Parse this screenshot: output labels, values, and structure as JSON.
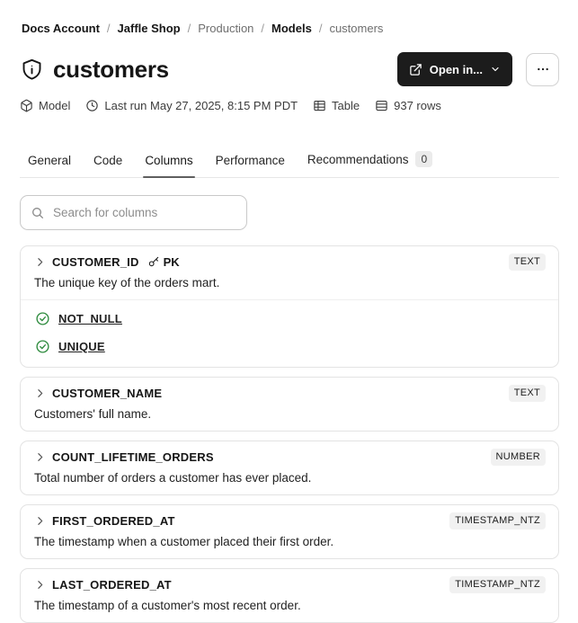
{
  "breadcrumb": {
    "separator": "/",
    "items": [
      {
        "label": "Docs Account",
        "muted": false
      },
      {
        "label": "Jaffle Shop",
        "muted": false
      },
      {
        "label": "Production",
        "muted": true
      },
      {
        "label": "Models",
        "muted": false
      },
      {
        "label": "customers",
        "muted": true
      }
    ]
  },
  "header": {
    "title": "customers",
    "resource_icon": "shield-exclamation-icon",
    "actions": {
      "open_in_label": "Open in...",
      "open_in_icons": [
        "external-link-icon",
        "chevron-down-icon"
      ],
      "more_icon": "ellipsis-icon"
    }
  },
  "meta": {
    "items": [
      {
        "icon": "cube-icon",
        "label": "Model"
      },
      {
        "icon": "clock-icon",
        "label": "Last run May 27, 2025, 8:15 PM PDT"
      },
      {
        "icon": "table-icon",
        "label": "Table"
      },
      {
        "icon": "rows-icon",
        "label": "937 rows"
      }
    ]
  },
  "tabs": {
    "items": [
      {
        "label": "General",
        "active": false
      },
      {
        "label": "Code",
        "active": false
      },
      {
        "label": "Columns",
        "active": true
      },
      {
        "label": "Performance",
        "active": false
      },
      {
        "label": "Recommendations",
        "active": false,
        "badge": "0"
      }
    ]
  },
  "search": {
    "placeholder": "Search for columns",
    "icon": "search-icon",
    "value": ""
  },
  "columns": [
    {
      "name": "CUSTOMER_ID",
      "pk_label": "PK",
      "pk_icon": "key-icon",
      "type": "TEXT",
      "description": "The unique key of the orders mart.",
      "tests": [
        "NOT_NULL",
        "UNIQUE"
      ],
      "test_icon": "check-circle-icon"
    },
    {
      "name": "CUSTOMER_NAME",
      "type": "TEXT",
      "description": "Customers' full name."
    },
    {
      "name": "COUNT_LIFETIME_ORDERS",
      "type": "NUMBER",
      "description": "Total number of orders a customer has ever placed."
    },
    {
      "name": "FIRST_ORDERED_AT",
      "type": "TIMESTAMP_NTZ",
      "description": "The timestamp when a customer placed their first order."
    },
    {
      "name": "LAST_ORDERED_AT",
      "type": "TIMESTAMP_NTZ",
      "description": "The timestamp of a customer's most recent order."
    }
  ],
  "colors": {
    "primary_button_bg": "#1c1c1c",
    "success_green": "#2e8b3e",
    "badge_bg": "#f1f1f1",
    "tab_underline": "#5f5f5f",
    "border": "#e3e3e3"
  }
}
